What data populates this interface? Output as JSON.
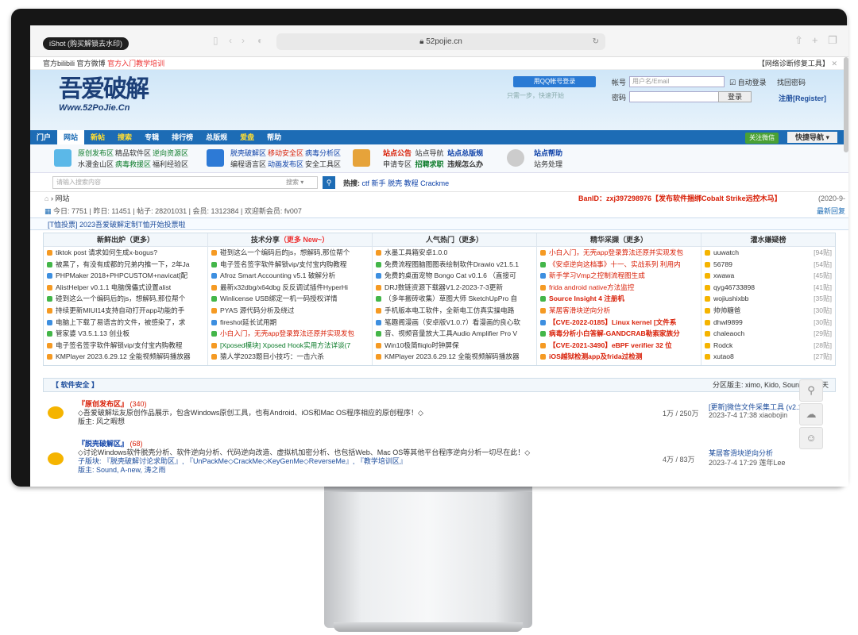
{
  "browser": {
    "ishot": "iShot (购买解锁去水印)",
    "url": "52pojie.cn"
  },
  "topbar": {
    "left1": "官方bilibili",
    "left2": "官方微博",
    "left3": "官方入门教学培训",
    "right": "【网络诊断修复工具】"
  },
  "header": {
    "logo_big": "吾爱破解",
    "logo_sub": "Www.52PoJie.Cn",
    "qq_login": "用QQ帐号登录",
    "qq_tip": "只需一步，快速开始",
    "account_label": "帐号",
    "account_placeholder": "用户名/Email",
    "auto_login": "自动登录",
    "find_password": "找回密码",
    "password_label": "密码",
    "login_btn": "登录",
    "register": "注册[Register]"
  },
  "nav": {
    "items": [
      "门户",
      "网站",
      "新帖",
      "搜索",
      "专辑",
      "排行榜",
      "总版规",
      "爱盘",
      "帮助"
    ],
    "wechat": "关注微信",
    "quick": "快捷导航"
  },
  "subnav": {
    "g1a": "原创发布区",
    "g1b": "精品软件区",
    "g1c": "逆向资源区",
    "g1d": "水漫金山区",
    "g1e": "病毒救援区",
    "g1f": "福利经验区",
    "g2a": "脱壳破解区",
    "g2b": "移动安全区",
    "g2c": "病毒分析区",
    "g2d": "编程语言区",
    "g2e": "动画发布区",
    "g2f": "安全工具区",
    "g3a": "站点公告",
    "g3b": "站点导航",
    "g3c": "站点总版规",
    "g3d": "申请专区",
    "g3e": "招聘求职",
    "g3f": "违规怎么办",
    "g4a": "站点帮助",
    "g4b": "站务处理"
  },
  "search": {
    "placeholder": "请输入搜索内容",
    "type": "搜索",
    "hot_label": "热搜:",
    "hot": [
      "ctf",
      "新手",
      "脱壳",
      "教程",
      "Crackme"
    ]
  },
  "crumb": {
    "home": "网站",
    "ban": "BanID：zxj397298976【发布软件捆绑Cobalt Strike远控木马】",
    "date": "(2020-9-"
  },
  "stats": {
    "text": "今日: 7751 | 昨日: 11451 | 帖子: 28201031 | 会员: 1312384 | 欢迎新会员: fv007",
    "latest": "最新回复"
  },
  "promo": "[T恤投票] 2023吾爱破解定制T恤开始投票啦",
  "columns": [
    {
      "title": "新鲜出炉（更多）",
      "rows": [
        "tiktok post 请求如何生成x-bogus?",
        "被黑了，有没有成都的兄弟内推一下，2年Ja",
        "PHPMaker 2018+PHPCUSTOM+navicat[配",
        "AlistHelper v0.1.1 电脑傀儡式设置alist",
        "碰到这么一个编码后的js，想解码,那位帮个",
        "持续更新MIUI14支持自动打开app功能的手",
        "电脑上下载了易语言的文件，被感染了，求",
        "管家婆 V3.5.1.13 创业板",
        "电子签名签字软件解锁vip/支付宝内购教程",
        "KMPlayer 2023.6.29.12 全能视频解码播放器"
      ]
    },
    {
      "title": "技术分享",
      "title_red": "（更多 New~）",
      "rows": [
        "碰到这么一个编码后的js，想解码,那位帮个",
        "电子签名签字软件解锁vip/支付宝内购教程",
        "Afroz Smart Accounting v5.1 破解分析",
        "最新x32dbg/x64dbg 反反调试插件HyperHi",
        "Winlicense USB绑定一机一码授权详情",
        "PYAS 源代码分析及绕过",
        "fireshot延长试用期",
        "小白入门，无壳app登录算法还原并实现发包",
        "[Xposed模块] Xposed Hook实用方法详谈(7",
        "猿人学2023题目小技巧：一击六杀"
      ]
    },
    {
      "title": "人气热门（更多）",
      "rows": [
        "水墨工具箱安卓1.0.0",
        "免费流程图脑图图表绘制软件Drawio v21.5.1",
        "免费的桌面宠物 Bongo Cat v0.1.6 （直接可",
        "DRJ数链资源下载器V1.2-2023-7-3更新",
        "（多年搬砖收集）草图大师 SketchUpPro 自",
        "手机版本电工软件，全新电工仿真实操电路",
        "笔趣阁漫画（安卓版V1.0.7）看漫画的良心软",
        "音、视频音量放大工具Audio Amplifier Pro V",
        "Win10极简fliqlo时钟屏保",
        "KMPlayer 2023.6.29.12 全能视频解码播放器"
      ]
    },
    {
      "title": "精华采撷（更多）",
      "rows": [
        "小白入门，无壳app登录算法还原并实现发包",
        "《安卓逆向这档事》十一、实战系列 利用内",
        "新手学习Vmp之控制流程图生成",
        "frida android native方法监控",
        "Source Insight 4 注册机",
        "某居客滑块逆向分析",
        "【CVE-2022-0185】Linux kernel [文件系",
        "病毒分析小白答解-GANDCRAB勒索家族分",
        "【CVE-2021-3490】eBPF verifier 32 位",
        "iOS越狱检测app及frida过检测"
      ]
    },
    {
      "title": "灌水嫌疑榜",
      "rows": [
        [
          "uuwatch",
          "[94贴]"
        ],
        [
          "56789",
          "[54贴]"
        ],
        [
          "xwawa",
          "[45贴]"
        ],
        [
          "qyg46733898",
          "[41贴]"
        ],
        [
          "wojiushixbb",
          "[35贴]"
        ],
        [
          "帅帅糖爸",
          "[30贴]"
        ],
        [
          "dhwl9899",
          "[30贴]"
        ],
        [
          "chaleaoch",
          "[29贴]"
        ],
        [
          "Rodck",
          "[28贴]"
        ],
        [
          "xutao8",
          "[27贴]"
        ]
      ]
    }
  ],
  "section": {
    "title": "【 软件安全 】",
    "moderators": "分区版主: ximo, Kido, Sound, 云在天"
  },
  "forums": [
    {
      "name": "『原创发布区』",
      "count": "(340)",
      "desc": "◇吾爱破解坛友原创作品展示，包含Windows原创工具，也有Android、iOS和Mac OS程序相应的原创程序！◇",
      "mods": "版主: 风之暇想",
      "posts": "1万 / 250万",
      "last": "[更新]微信文件采集工具 (v2.1)",
      "last_date": "2023-7-4 17:38 xiaobojin"
    },
    {
      "name": "『脱壳破解区』",
      "count": "(68)",
      "desc": "◇讨论Windows软件脱壳分析、软件逆向分析、代码逆向改造、虚拟机加密分析、也包括Web、Mac OS等其他平台程序逆向分析一切尽在此！◇",
      "sub": "子版块: 『脱壳破解讨论求助区』, 『UnPackMe◇CrackMe◇KeyGenMe◇ReverseMe』, 『教学培训区』",
      "mods": "版主: Sound, A-new, 涛之雨",
      "posts": "4万 / 83万",
      "last": "某居客滑块逆向分析",
      "last_date": "2023-7-4 17:29 莲年Lee"
    }
  ],
  "colors": {
    "nav_blue": "#1d6cb5",
    "link_red": "#d81e06",
    "link_green": "#0a7a28",
    "link_blue": "#0d41a8"
  }
}
